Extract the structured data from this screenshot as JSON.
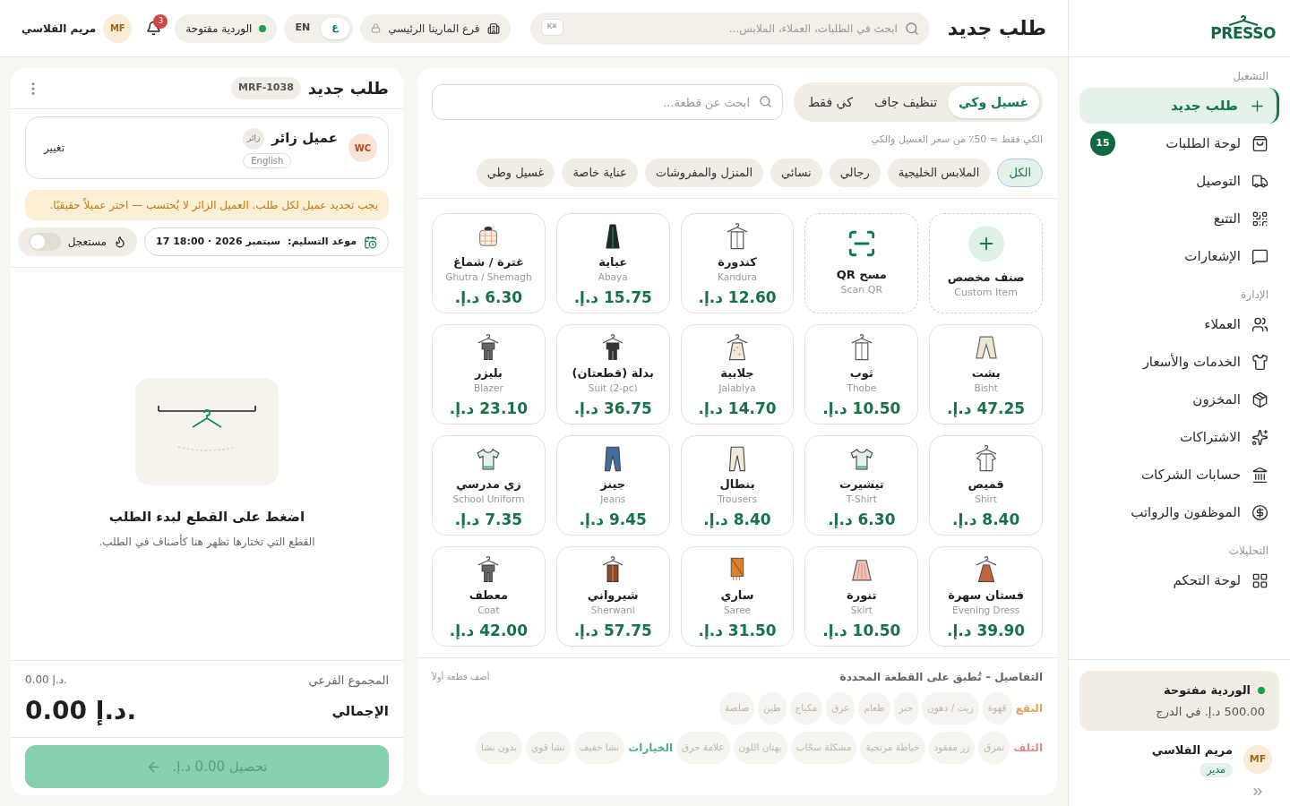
{
  "sidebar": {
    "logo": "PRESSO",
    "sections": [
      {
        "title": "التشغيل",
        "items": [
          {
            "label": "طلب جديد",
            "selected": true
          },
          {
            "label": "لوحة الطلبات",
            "selected": false,
            "badge": "15"
          },
          {
            "label": "التوصيل",
            "selected": false
          },
          {
            "label": "التتبع",
            "selected": false
          },
          {
            "label": "الإشعارات",
            "selected": false
          }
        ]
      },
      {
        "title": "الإدارة",
        "items": [
          {
            "label": "العملاء",
            "selected": false
          },
          {
            "label": "الخدمات والأسعار",
            "selected": false
          },
          {
            "label": "المخزون",
            "selected": false
          },
          {
            "label": "الاشتراكات",
            "selected": false
          },
          {
            "label": "حسابات الشركات",
            "selected": false
          },
          {
            "label": "الموظفون والرواتب",
            "selected": false
          }
        ]
      },
      {
        "title": "التحليلات",
        "items": [
          {
            "label": "لوحة التحكم",
            "selected": false
          }
        ]
      }
    ],
    "shift": {
      "title": "الوردية مفتوحة",
      "cash": "500.00 د.إ. في الدرج"
    },
    "user": {
      "initials": "MF",
      "name": "مريم الفلاسي",
      "role": "مدير"
    }
  },
  "header": {
    "title": "طلب جديد",
    "search": {
      "placeholder": "ابحث في الطلبات، العملاء، الملابس...",
      "shortcut": "K⌘"
    },
    "branch": "فرع المارينا الرئيسي",
    "languages": [
      {
        "label": "ع",
        "selected": true
      },
      {
        "label": "EN",
        "selected": false
      }
    ],
    "shift": "الوردية مفتوحة",
    "notifications": "3",
    "user": {
      "initials": "MF",
      "name": "مريم الفلاسي"
    }
  },
  "catalog": {
    "services": [
      {
        "label": "غسيل وكي",
        "selected": true
      },
      {
        "label": "تنظيف جاف",
        "selected": false
      },
      {
        "label": "كي فقط",
        "selected": false
      }
    ],
    "search": {
      "placeholder": "ابحث عن قطعة..."
    },
    "hint": "الكي فقط ≈ 50٪ من سعر الغسيل والكي",
    "categories": [
      {
        "label": "الكل",
        "selected": true
      },
      {
        "label": "الملابس الخليجية",
        "selected": false
      },
      {
        "label": "رجالي",
        "selected": false
      },
      {
        "label": "نسائي",
        "selected": false
      },
      {
        "label": "المنزل والمفروشات",
        "selected": false
      },
      {
        "label": "عناية خاصة",
        "selected": false
      },
      {
        "label": "غسيل وطي",
        "selected": false
      }
    ],
    "items": [
      {
        "kind": "custom",
        "name": "صنف مخصص",
        "name_en": "Custom Item"
      },
      {
        "kind": "scan",
        "name": "مسح QR",
        "name_en": "Scan QR"
      },
      {
        "kind": "garment",
        "name": "كندورة",
        "name_en": "Kandura",
        "price": "12.60 د.إ."
      },
      {
        "kind": "garment",
        "name": "عباية",
        "name_en": "Abaya",
        "price": "15.75 د.إ."
      },
      {
        "kind": "garment",
        "name": "غترة / شماغ",
        "name_en": "Ghutra / Shemagh",
        "price": "6.30 د.إ."
      },
      {
        "kind": "garment",
        "name": "بشت",
        "name_en": "Bisht",
        "price": "47.25 د.إ."
      },
      {
        "kind": "garment",
        "name": "ثوب",
        "name_en": "Thobe",
        "price": "10.50 د.إ."
      },
      {
        "kind": "garment",
        "name": "جلابية",
        "name_en": "Jalabiya",
        "price": "14.70 د.إ."
      },
      {
        "kind": "garment",
        "name": "بدلة (قطعتان)",
        "name_en": "Suit (2-pc)",
        "price": "36.75 د.إ."
      },
      {
        "kind": "garment",
        "name": "بليزر",
        "name_en": "Blazer",
        "price": "23.10 د.إ."
      },
      {
        "kind": "garment",
        "name": "قميص",
        "name_en": "Shirt",
        "price": "8.40 د.إ."
      },
      {
        "kind": "garment",
        "name": "تيشيرت",
        "name_en": "T-Shirt",
        "price": "6.30 د.إ."
      },
      {
        "kind": "garment",
        "name": "بنطال",
        "name_en": "Trousers",
        "price": "8.40 د.إ."
      },
      {
        "kind": "garment",
        "name": "جينز",
        "name_en": "Jeans",
        "price": "9.45 د.إ."
      },
      {
        "kind": "garment",
        "name": "زي مدرسي",
        "name_en": "School Uniform",
        "price": "7.35 د.إ."
      },
      {
        "kind": "garment",
        "name": "فستان سهرة",
        "name_en": "Evening Dress",
        "price": "39.90 د.إ."
      },
      {
        "kind": "garment",
        "name": "تنورة",
        "name_en": "Skirt",
        "price": "10.50 د.إ."
      },
      {
        "kind": "garment",
        "name": "ساري",
        "name_en": "Saree",
        "price": "31.50 د.إ."
      },
      {
        "kind": "garment",
        "name": "شيرواني",
        "name_en": "Sherwani",
        "price": "57.75 د.إ."
      },
      {
        "kind": "garment",
        "name": "معطف",
        "name_en": "Coat",
        "price": "42.00 د.إ."
      }
    ],
    "details": {
      "title": "التفاصيل – تُطبق على القطعة المحددة",
      "note": "أضف قطعة أولاً",
      "disabled": true,
      "groups": [
        {
          "label": "البقع",
          "color": "#e0a458",
          "chips": [
            "قهوة",
            "زيت / دهون",
            "حبر",
            "طعام",
            "عرق",
            "مكياج",
            "طين",
            "صلصة"
          ]
        },
        {
          "label": "التلف",
          "color": "#e58b8b",
          "chips": [
            "تمزق",
            "زر مفقود",
            "خياطة مرتخية",
            "مشكلة سحّاب",
            "بهتان اللون",
            "علامة حرق"
          ]
        },
        {
          "label": "الخيارات",
          "color": "#4fae8a",
          "chips": [
            "نشا خفيف",
            "نشا قوي",
            "بدون نشا"
          ]
        }
      ]
    }
  },
  "order": {
    "title": "طلب جديد",
    "number": "MRF-1038",
    "customer": {
      "initials": "WC",
      "name": "عميل زائر",
      "tag": "زائر",
      "language": "English",
      "change": "تغيير"
    },
    "warning": "يجب تحديد عميل لكل طلب. العميل الزائر لا يُحتسب — اختر عميلاً حقيقيًا.",
    "delivery": {
      "label": "موعد التسليم:",
      "value": "17 18:00 · 2026 سبتمبر"
    },
    "urgent": {
      "label": "مستعجل",
      "on": false
    },
    "empty": {
      "title": "اضغط على القطع لبدء الطلب",
      "subtitle": "القطع التي تختارها تظهر هنا كأصناف في الطلب."
    },
    "subtotal": {
      "label": "المجموع الفرعي",
      "value": "0.00 د.إ."
    },
    "total": {
      "label": "الإجمالي",
      "value": "0.00 د.إ."
    },
    "pay": {
      "label": "تحصيل 0.00 د.إ.",
      "disabled": true
    }
  }
}
